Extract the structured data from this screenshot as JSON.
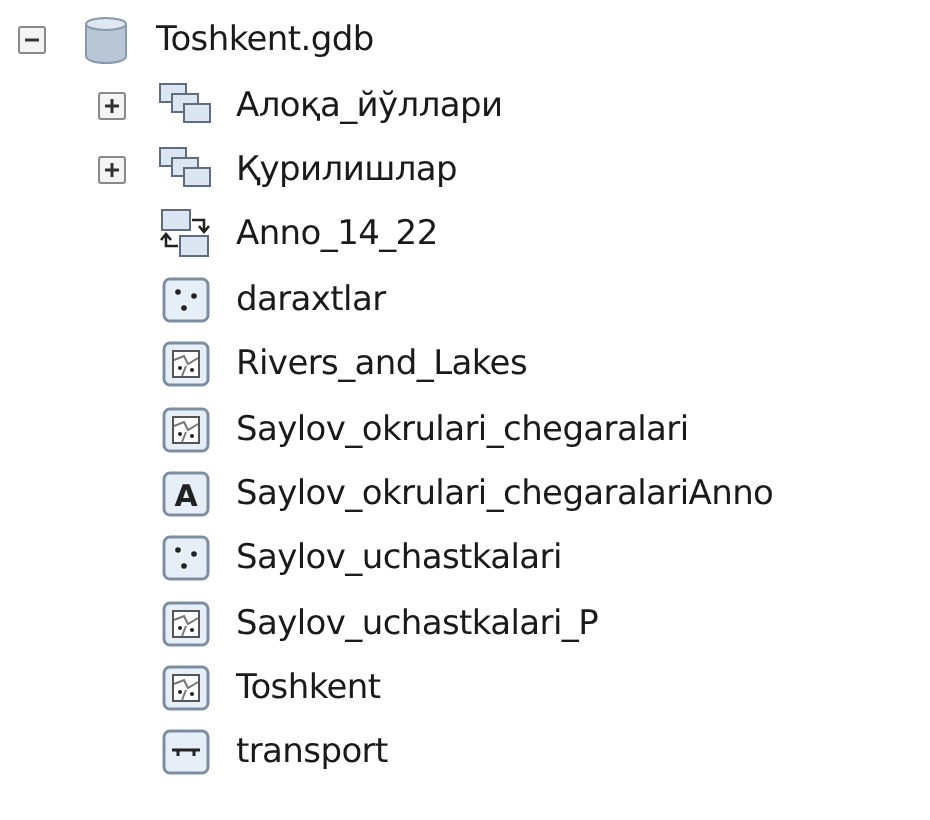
{
  "tree": {
    "label": "Toshkent.gdb",
    "kind": "database",
    "expanded": true,
    "children": [
      {
        "label": "Алоқа_йўллари",
        "kind": "dataset",
        "expanded": false
      },
      {
        "label": "Қурилишлар",
        "kind": "dataset",
        "expanded": false
      },
      {
        "label": "Anno_14_22",
        "kind": "relationship"
      },
      {
        "label": "daraxtlar",
        "kind": "point"
      },
      {
        "label": "Rivers_and_Lakes",
        "kind": "polygon"
      },
      {
        "label": "Saylov_okrulari_chegaralari",
        "kind": "polygon"
      },
      {
        "label": "Saylov_okrulari_chegaralariAnno",
        "kind": "annotation",
        "icon_text": "A"
      },
      {
        "label": "Saylov_uchastkalari",
        "kind": "point"
      },
      {
        "label": "Saylov_uchastkalari_P",
        "kind": "polygon"
      },
      {
        "label": "Toshkent",
        "kind": "polygon"
      },
      {
        "label": "transport",
        "kind": "line"
      }
    ]
  }
}
